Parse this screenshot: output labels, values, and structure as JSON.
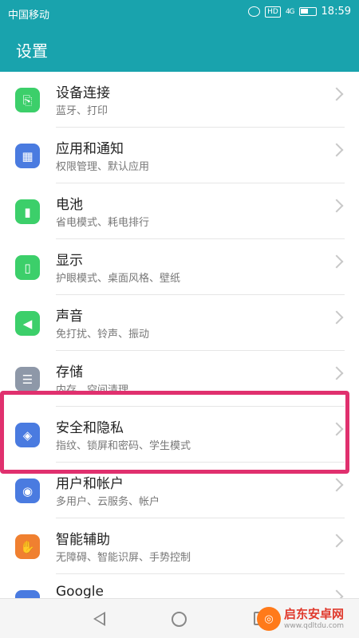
{
  "status_bar": {
    "carrier": "中国移动",
    "time": "18:59",
    "hd_badge": "HD",
    "signal_label": "4G"
  },
  "app_bar": {
    "title": "设置"
  },
  "settings_items": [
    {
      "label": "设备连接",
      "sub": "蓝牙、打印",
      "icon": "device-link-icon",
      "color": "#3ccf6a",
      "glyph": "⎘"
    },
    {
      "label": "应用和通知",
      "sub": "权限管理、默认应用",
      "icon": "apps-grid-icon",
      "color": "#4a7be0",
      "glyph": "▦"
    },
    {
      "label": "电池",
      "sub": "省电模式、耗电排行",
      "icon": "battery-icon",
      "color": "#3ccf6a",
      "glyph": "▮"
    },
    {
      "label": "显示",
      "sub": "护眼模式、桌面风格、壁纸",
      "icon": "display-icon",
      "color": "#3ccf6a",
      "glyph": "▯"
    },
    {
      "label": "声音",
      "sub": "免打扰、铃声、振动",
      "icon": "speaker-icon",
      "color": "#3ccf6a",
      "glyph": "◀"
    },
    {
      "label": "存储",
      "sub": "内存、空间清理",
      "icon": "storage-icon",
      "color": "#8e98a8",
      "glyph": "☰"
    },
    {
      "label": "安全和隐私",
      "sub": "指纹、锁屏和密码、学生模式",
      "icon": "shield-icon",
      "color": "#4a7be0",
      "glyph": "◈"
    },
    {
      "label": "用户和帐户",
      "sub": "多用户、云服务、帐户",
      "icon": "user-icon",
      "color": "#4a7be0",
      "glyph": "◉"
    },
    {
      "label": "智能辅助",
      "sub": "无障碍、智能识屏、手势控制",
      "icon": "hand-icon",
      "color": "#f08030",
      "glyph": "✋"
    },
    {
      "label": "Google",
      "sub": "",
      "icon": "google-icon",
      "color": "#4a7be0",
      "glyph": "G"
    }
  ],
  "watermark": {
    "title": "启东安卓网",
    "url": "www.qdltdu.com"
  },
  "colors": {
    "accent": "#19a3ad",
    "highlight": "#e0306e"
  }
}
